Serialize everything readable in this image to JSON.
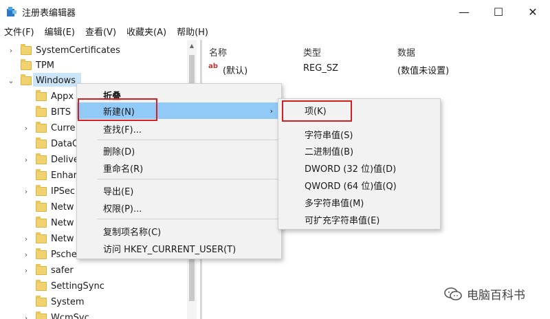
{
  "window": {
    "title": "注册表编辑器",
    "minimize": "—",
    "maximize": "☐",
    "close": "✕"
  },
  "menubar": [
    "文件(F)",
    "编辑(E)",
    "查看(V)",
    "收藏夹(A)",
    "帮助(H)"
  ],
  "tree": {
    "items": [
      {
        "label": "SystemCertificates",
        "expander": "›"
      },
      {
        "label": "TPM",
        "expander": ""
      },
      {
        "label": "Windows",
        "expander": "⌄",
        "selected": true
      },
      {
        "label": "Appx",
        "expander": ""
      },
      {
        "label": "BITS",
        "expander": ""
      },
      {
        "label": "Curre",
        "expander": "›"
      },
      {
        "label": "DataC",
        "expander": ""
      },
      {
        "label": "Delive",
        "expander": "›"
      },
      {
        "label": "Enhar",
        "expander": ""
      },
      {
        "label": "IPSec",
        "expander": "›"
      },
      {
        "label": "Netw",
        "expander": ""
      },
      {
        "label": "Netw",
        "expander": ""
      },
      {
        "label": "Netw",
        "expander": "›"
      },
      {
        "label": "Psche",
        "expander": "›"
      },
      {
        "label": "safer",
        "expander": "›"
      },
      {
        "label": "SettingSync",
        "expander": ""
      },
      {
        "label": "System",
        "expander": ""
      },
      {
        "label": "WcmSvc",
        "expander": "›"
      }
    ]
  },
  "values_pane": {
    "headers": {
      "name": "名称",
      "type": "类型",
      "data": "数据"
    },
    "rows": [
      {
        "icon": "ab",
        "name": "(默认)",
        "type": "REG_SZ",
        "data": "(数值未设置)"
      }
    ]
  },
  "context_menu": {
    "items": [
      {
        "label": "折叠",
        "bold": true
      },
      {
        "label": "新建(N)",
        "highlighted": true,
        "arrow": "›"
      },
      {
        "label": "查找(F)..."
      },
      {
        "label": "删除(D)"
      },
      {
        "label": "重命名(R)"
      },
      {
        "label": "导出(E)"
      },
      {
        "label": "权限(P)..."
      },
      {
        "label": "复制项名称(C)"
      },
      {
        "label": "访问 HKEY_CURRENT_USER(T)"
      }
    ]
  },
  "submenu": {
    "items": [
      "项(K)",
      "字符串值(S)",
      "二进制值(B)",
      "DWORD (32 位)值(D)",
      "QWORD (64 位)值(Q)",
      "多字符串值(M)",
      "可扩充字符串值(E)"
    ]
  },
  "watermark": {
    "text": "电脑百科书"
  },
  "colors": {
    "highlight": "#91c9f7",
    "callout": "#d22020",
    "folder": "#f0d271",
    "selection": "#cce4f7"
  }
}
